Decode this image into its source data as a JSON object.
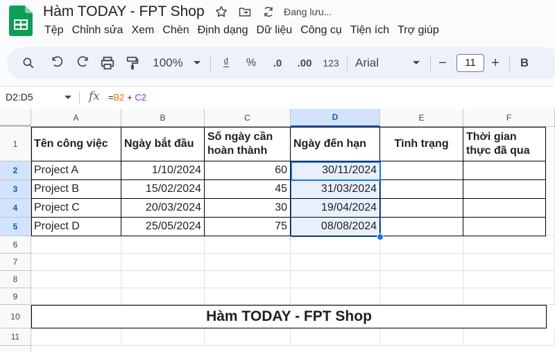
{
  "app": {
    "doc_title": "Hàm TODAY - FPT Shop",
    "save_status": "Đang lưu...",
    "menu": [
      "Tệp",
      "Chỉnh sửa",
      "Xem",
      "Chèn",
      "Định dạng",
      "Dữ liệu",
      "Công cụ",
      "Tiện ích",
      "Trợ giúp"
    ]
  },
  "toolbar": {
    "zoom": "100%",
    "currency": "₫",
    "percent": "%",
    "dec_decrease": ".0",
    "dec_increase": ".00",
    "number_format": "123",
    "font": "Arial",
    "font_size": "11",
    "bold": "B",
    "minus": "−",
    "plus": "+"
  },
  "formula_bar": {
    "name_box": "D2:D5",
    "fx": "fx",
    "formula_prefix": "=",
    "ref1": "B2",
    "operator": " + ",
    "ref2": "C2"
  },
  "sheet": {
    "columns": [
      "A",
      "B",
      "C",
      "D",
      "E",
      "F"
    ],
    "selected_column": "D",
    "row_numbers": [
      "1",
      "2",
      "3",
      "4",
      "5",
      "6",
      "7",
      "8",
      "9",
      "10",
      "11"
    ],
    "selected_rows": [
      "2",
      "3",
      "4",
      "5"
    ],
    "headers": [
      "Tên công việc",
      "Ngày bắt đầu",
      "Số ngày cần hoàn thành",
      "Ngày đến hạn",
      "Tình trạng",
      "Thời gian thực đã qua"
    ],
    "rows": [
      {
        "task": "Project A",
        "start": "1/10/2024",
        "days": "60",
        "due": "30/11/2024"
      },
      {
        "task": "Project B",
        "start": "15/02/2024",
        "days": "45",
        "due": "31/03/2024"
      },
      {
        "task": "Project C",
        "start": "20/03/2024",
        "days": "30",
        "due": "19/04/2024"
      },
      {
        "task": "Project D",
        "start": "25/05/2024",
        "days": "75",
        "due": "08/08/2024"
      }
    ],
    "merged_title": "Hàm TODAY - FPT Shop"
  },
  "colors": {
    "accent": "#1a73e8",
    "selection_fill": "#e8f0fe",
    "header_selected": "#d3e3fd",
    "logo_green": "#0f9d58",
    "formula_ref1": "#e8710a",
    "formula_ref2": "#8430ce"
  }
}
